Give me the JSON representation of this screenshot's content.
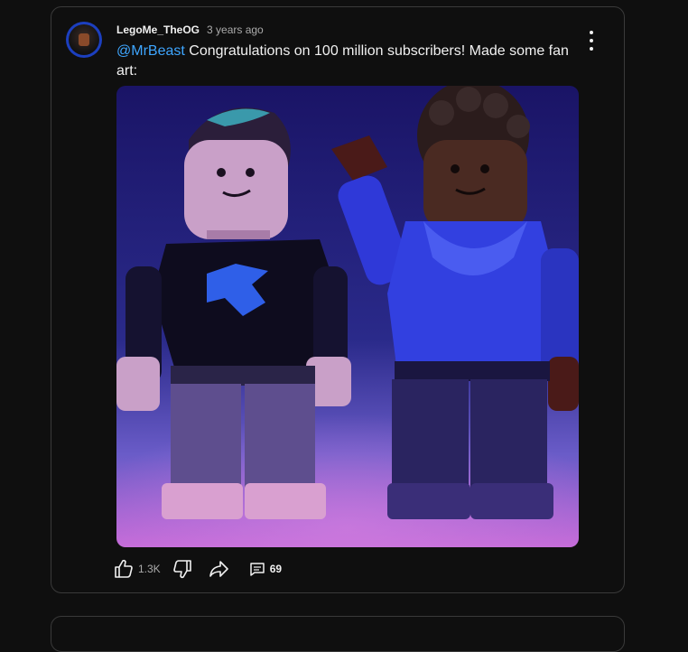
{
  "post": {
    "author": "LegoMe_TheOG",
    "timestamp": "3 years ago",
    "mention": "@MrBeast",
    "text": " Congratulations on 100 million subscribers! Made some fan art:",
    "image_alt": "Two LEGO minifigures fan art",
    "likes": "1.3K",
    "replies": "69"
  },
  "icons": {
    "menu": "more-vert-icon",
    "like": "thumbs-up-icon",
    "dislike": "thumbs-down-icon",
    "share": "share-icon",
    "comment": "comment-icon"
  },
  "colors": {
    "background": "#0f0f0f",
    "border": "#3a3a3a",
    "mention": "#3ea6ff",
    "text": "#f1f1f1",
    "muted": "#aaaaaa"
  }
}
